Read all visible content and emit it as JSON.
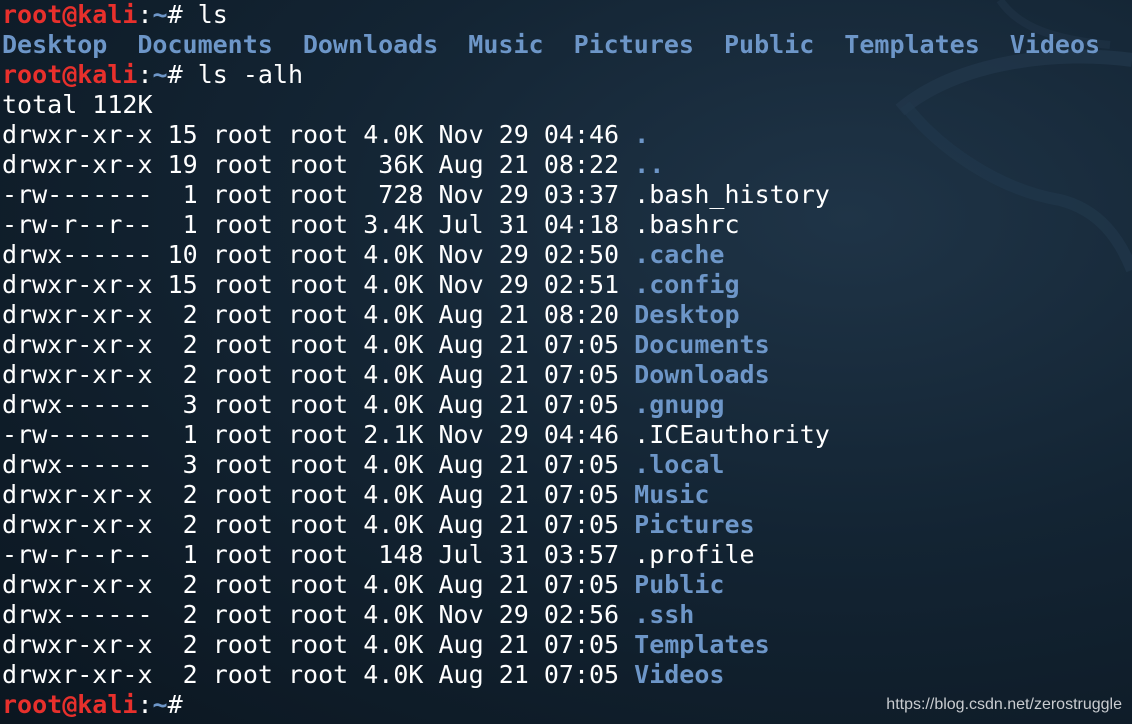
{
  "prompt": {
    "user": "root",
    "at": "@",
    "host": "kali",
    "colon": ":",
    "path": "~",
    "symbol": "# "
  },
  "commands": [
    "ls",
    "ls -alh"
  ],
  "ls_output": [
    "Desktop",
    "Documents",
    "Downloads",
    "Music",
    "Pictures",
    "Public",
    "Templates",
    "Videos"
  ],
  "total": "total 112K",
  "entries": [
    {
      "prefix": "drwxr-xr-x 15 root root 4.0K Nov 29 04:46 ",
      "name": ".",
      "dir": true
    },
    {
      "prefix": "drwxr-xr-x 19 root root  36K Aug 21 08:22 ",
      "name": "..",
      "dir": true
    },
    {
      "prefix": "-rw-------  1 root root  728 Nov 29 03:37 ",
      "name": ".bash_history",
      "dir": false
    },
    {
      "prefix": "-rw-r--r--  1 root root 3.4K Jul 31 04:18 ",
      "name": ".bashrc",
      "dir": false
    },
    {
      "prefix": "drwx------ 10 root root 4.0K Nov 29 02:50 ",
      "name": ".cache",
      "dir": true
    },
    {
      "prefix": "drwxr-xr-x 15 root root 4.0K Nov 29 02:51 ",
      "name": ".config",
      "dir": true
    },
    {
      "prefix": "drwxr-xr-x  2 root root 4.0K Aug 21 08:20 ",
      "name": "Desktop",
      "dir": true
    },
    {
      "prefix": "drwxr-xr-x  2 root root 4.0K Aug 21 07:05 ",
      "name": "Documents",
      "dir": true
    },
    {
      "prefix": "drwxr-xr-x  2 root root 4.0K Aug 21 07:05 ",
      "name": "Downloads",
      "dir": true
    },
    {
      "prefix": "drwx------  3 root root 4.0K Aug 21 07:05 ",
      "name": ".gnupg",
      "dir": true
    },
    {
      "prefix": "-rw-------  1 root root 2.1K Nov 29 04:46 ",
      "name": ".ICEauthority",
      "dir": false
    },
    {
      "prefix": "drwx------  3 root root 4.0K Aug 21 07:05 ",
      "name": ".local",
      "dir": true
    },
    {
      "prefix": "drwxr-xr-x  2 root root 4.0K Aug 21 07:05 ",
      "name": "Music",
      "dir": true
    },
    {
      "prefix": "drwxr-xr-x  2 root root 4.0K Aug 21 07:05 ",
      "name": "Pictures",
      "dir": true
    },
    {
      "prefix": "-rw-r--r--  1 root root  148 Jul 31 03:57 ",
      "name": ".profile",
      "dir": false
    },
    {
      "prefix": "drwxr-xr-x  2 root root 4.0K Aug 21 07:05 ",
      "name": "Public",
      "dir": true
    },
    {
      "prefix": "drwx------  2 root root 4.0K Nov 29 02:56 ",
      "name": ".ssh",
      "dir": true
    },
    {
      "prefix": "drwxr-xr-x  2 root root 4.0K Aug 21 07:05 ",
      "name": "Templates",
      "dir": true
    },
    {
      "prefix": "drwxr-xr-x  2 root root 4.0K Aug 21 07:05 ",
      "name": "Videos",
      "dir": true
    }
  ],
  "watermark": "https://blog.csdn.net/zerostruggle",
  "colors": {
    "background": "#132433",
    "user_host": "#e8302c",
    "directory": "#6d96c8",
    "text": "#ffffff"
  }
}
